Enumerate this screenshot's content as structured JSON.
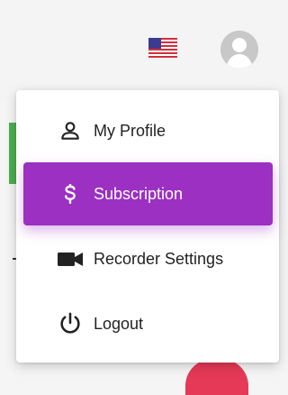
{
  "header": {
    "language_flag_icon": "us-flag-icon",
    "avatar_icon": "user-avatar-icon"
  },
  "menu": {
    "items": [
      {
        "label": "My Profile",
        "icon": "person-icon",
        "active": false
      },
      {
        "label": "Subscription",
        "icon": "dollar-icon",
        "active": true
      },
      {
        "label": "Recorder Settings",
        "icon": "video-camera-icon",
        "active": false
      },
      {
        "label": "Logout",
        "icon": "power-icon",
        "active": false
      }
    ]
  },
  "colors": {
    "accent": "#9b30c2",
    "green": "#4caf50",
    "red": "#e53957"
  }
}
